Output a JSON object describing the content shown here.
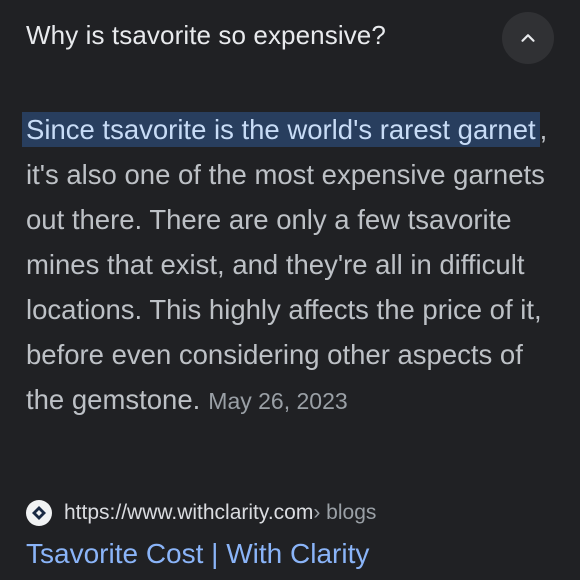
{
  "question": {
    "title": "Why is tsavorite so expensive?",
    "collapse_icon": "chevron-up-icon"
  },
  "answer": {
    "highlighted_text": "Since tsavorite is the world's rarest garnet",
    "body_text": ", it's also one of the most expensive garnets out there. There are only a few tsavorite mines that exist, and they're all in difficult locations. This highly affects the price of it, before even considering other aspects of the gemstone.",
    "date": "May 26, 2023"
  },
  "source": {
    "favicon": "withclarity-logo-icon",
    "url": "https://www.withclarity.com",
    "path": " › blogs",
    "link_title": "Tsavorite Cost | With Clarity"
  },
  "colors": {
    "background": "#202124",
    "highlight_background": "#283e5e",
    "link": "#8ab4f8"
  }
}
